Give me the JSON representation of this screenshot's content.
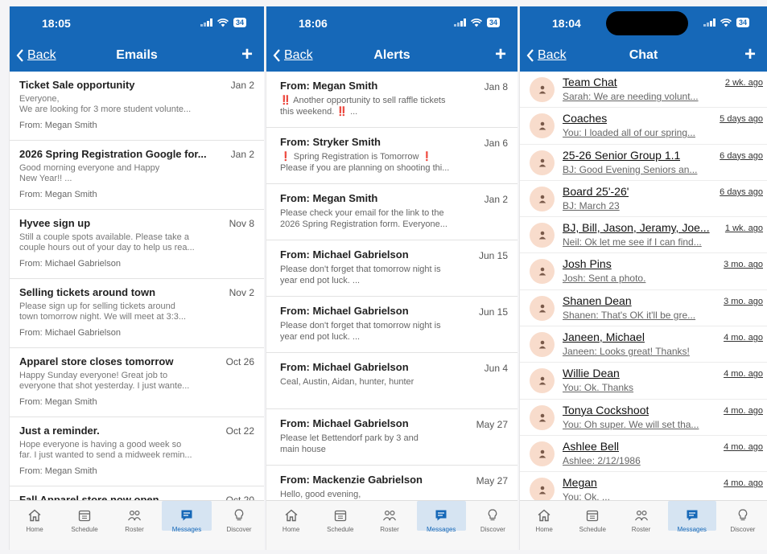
{
  "common": {
    "back_label": "Back",
    "add_label": "+",
    "tabs": [
      {
        "label": "Home"
      },
      {
        "label": "Schedule"
      },
      {
        "label": "Roster"
      },
      {
        "label": "Messages"
      },
      {
        "label": "Discover"
      }
    ],
    "active_tab": "Messages",
    "accent_color": "#1668b8",
    "battery": "34"
  },
  "emails_screen": {
    "time": "18:05",
    "title": "Emails",
    "items": [
      {
        "subject": "Ticket Sale opportunity",
        "date": "Jan 2",
        "preview": "Everyone,\n We are looking for 3 more student volunte...",
        "from": "From: Megan Smith"
      },
      {
        "subject": "2026 Spring Registration Google for...",
        "date": "Jan 2",
        "preview": "Good morning everyone and Happy\nNew Year!! ...",
        "from": "From: Megan Smith"
      },
      {
        "subject": "Hyvee sign up",
        "date": "Nov 8",
        "preview": "Still a couple spots available.  Please take a\ncouple hours out of your day to help us rea...",
        "from": "From: Michael Gabrielson"
      },
      {
        "subject": "Selling tickets around town",
        "date": "Nov 2",
        "preview": "Please sign up for selling tickets around\ntown tomorrow night.  We will meet at 3:3...",
        "from": "From: Michael Gabrielson"
      },
      {
        "subject": "Apparel store closes tomorrow",
        "date": "Oct 26",
        "preview": "Happy Sunday everyone!  Great job to\neveryone that shot yesterday. I just wante...",
        "from": "From: Megan Smith"
      },
      {
        "subject": "Just a reminder.",
        "date": "Oct 22",
        "preview": "Hope everyone is having a good week so\nfar. I just wanted to send a midweek remin...",
        "from": "From: Megan Smith"
      },
      {
        "subject": "Fall Apparel store now open",
        "date": "Oct 20",
        "preview": "",
        "from": ""
      }
    ]
  },
  "alerts_screen": {
    "time": "18:06",
    "title": "Alerts",
    "items": [
      {
        "subject": "From: Megan Smith",
        "date": "Jan 8",
        "preview": "‼️ Another opportunity to sell raffle tickets\nthis weekend. ‼️ ..."
      },
      {
        "subject": "From: Stryker Smith",
        "date": "Jan 6",
        "preview": "❗ Spring Registration is Tomorrow  ❗\nPlease if you are planning on shooting thi..."
      },
      {
        "subject": "From: Megan Smith",
        "date": "Jan 2",
        "preview": "Please check your email for the link to the\n2026 Spring Registration form.  Everyone..."
      },
      {
        "subject": "From: Michael Gabrielson",
        "date": "Jun 15",
        "preview": "Please don't forget that tomorrow night is\nyear end pot luck. ..."
      },
      {
        "subject": "From: Michael Gabrielson",
        "date": "Jun 15",
        "preview": "Please don't forget that tomorrow night is\nyear end pot luck. ..."
      },
      {
        "subject": "From: Michael Gabrielson",
        "date": "Jun 4",
        "preview": "Ceal, Austin, Aidan, hunter, hunter"
      },
      {
        "subject": "From: Michael Gabrielson",
        "date": "May 27",
        "preview": "Please let Bettendorf park by 3 and\nmain house"
      },
      {
        "subject": "From: Mackenzie Gabrielson",
        "date": "May 27",
        "preview": "Hello, good evening,"
      }
    ]
  },
  "chat_screen": {
    "time": "18:04",
    "title": "Chat",
    "items": [
      {
        "name": "Team Chat",
        "message": "Sarah: We are needing volunt...",
        "ago": "2 wk. ago"
      },
      {
        "name": "Coaches",
        "message": "You: I loaded all of our spring...",
        "ago": "5 days ago"
      },
      {
        "name": "25-26 Senior Group 1.1",
        "message": "BJ: Good Evening Seniors an...",
        "ago": "6 days ago"
      },
      {
        "name": "Board 25'-26'",
        "message": "BJ: March 23",
        "ago": "6 days ago"
      },
      {
        "name": "BJ, Bill, Jason, Jeramy, Joe...",
        "message": "Neil: Ok let me see if I can find...",
        "ago": "1 wk. ago"
      },
      {
        "name": "Josh Pins",
        "message": "Josh: Sent a photo.",
        "ago": "3 mo. ago"
      },
      {
        "name": "Shanen Dean",
        "message": "Shanen: That's OK it'll be gre...",
        "ago": "3 mo. ago"
      },
      {
        "name": "Janeen, Michael",
        "message": "Janeen: Looks great! Thanks!",
        "ago": "4 mo. ago"
      },
      {
        "name": "Willie Dean",
        "message": "You: Ok. Thanks",
        "ago": "4 mo. ago"
      },
      {
        "name": "Tonya Cockshoot",
        "message": "You: Oh super. We will set tha...",
        "ago": "4 mo. ago"
      },
      {
        "name": "Ashlee Bell",
        "message": "Ashlee: 2/12/1986",
        "ago": "4 mo. ago"
      },
      {
        "name": "Megan",
        "message": "You: Ok. ...",
        "ago": "4 mo. ago"
      }
    ]
  }
}
